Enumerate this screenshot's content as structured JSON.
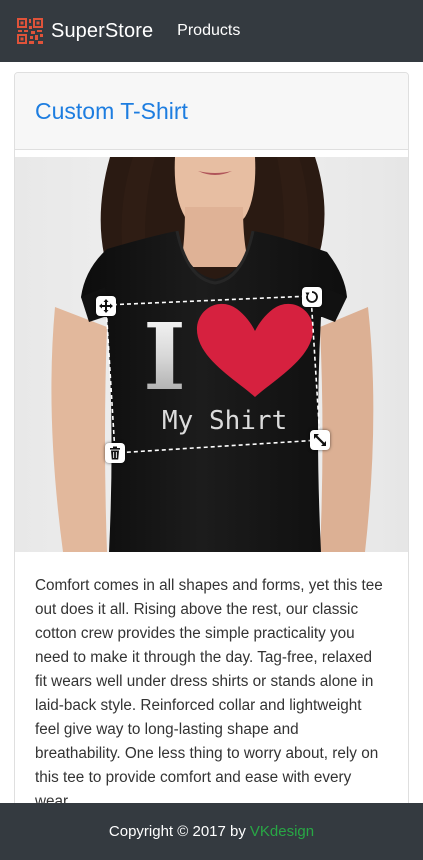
{
  "navbar": {
    "brand_name": "SuperStore",
    "logo_icon": "qr-code-icon",
    "links": [
      "Products"
    ]
  },
  "product": {
    "title": "Custom T-Shirt",
    "image": {
      "shirt_print_line1": "I",
      "shirt_print_line2": "My Shirt",
      "handles": [
        "move-icon",
        "rotate-icon",
        "delete-icon",
        "resize-icon"
      ]
    },
    "description": "Comfort comes in all shapes and forms, yet this tee out does it all. Rising above the rest, our classic cotton crew provides the simple practicality you need to make it through the day. Tag-free, relaxed fit wears well under dress shirts or stands alone in laid-back style. Reinforced collar and lightweight feel give way to long-lasting shape and breathability. One less thing to worry about, rely on this tee to provide comfort and ease with every wear."
  },
  "footer": {
    "copyright": "Copyright © 2017 by",
    "author_link": "VKdesign"
  },
  "colors": {
    "navbar_bg": "#343a40",
    "title": "#1d7de0",
    "heart": "#d6213f",
    "footer_link": "#28a745"
  }
}
